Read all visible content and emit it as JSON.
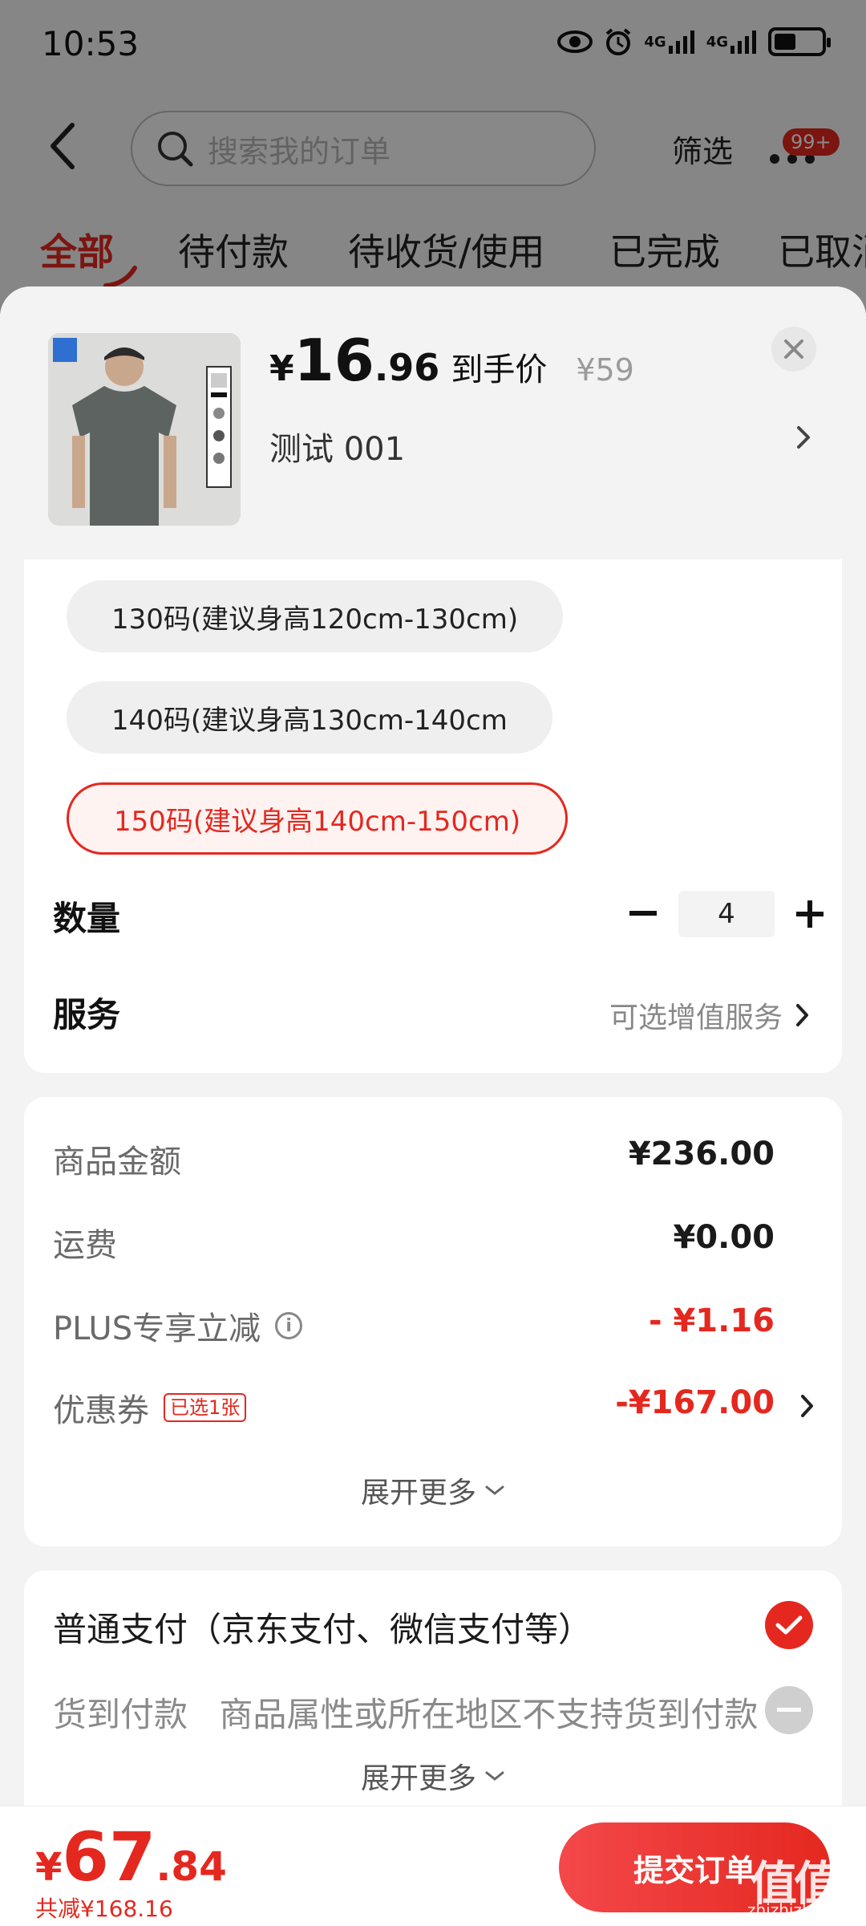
{
  "status_bar": {
    "time": "10:53",
    "signal_1": "4G",
    "signal_2": "4G"
  },
  "top_nav": {
    "search_placeholder": "搜索我的订单",
    "filter_label": "筛选",
    "more_badge": "99+"
  },
  "tabs": [
    {
      "label": "全部",
      "active": true
    },
    {
      "label": "待付款",
      "active": false
    },
    {
      "label": "待收货/使用",
      "active": false
    },
    {
      "label": "已完成",
      "active": false
    },
    {
      "label": "已取消",
      "active": false
    }
  ],
  "product": {
    "price_currency": "¥",
    "price_int": "16",
    "price_dec": ".96",
    "price_tag": "到手价",
    "original_price": "¥59",
    "spec": "测试  001",
    "image_icon": "gray-tshirt-photo"
  },
  "sizes": [
    {
      "label": "130码(建议身高120cm-130cm)",
      "selected": false
    },
    {
      "label": "140码(建议身高130cm-140cm",
      "selected": false
    },
    {
      "label": "150码(建议身高140cm-150cm)",
      "selected": true
    }
  ],
  "quantity": {
    "label": "数量",
    "value": "4"
  },
  "service": {
    "label": "服务",
    "value": "可选增值服务"
  },
  "price_detail": {
    "rows": [
      {
        "label": "商品金额",
        "value": "¥236.00"
      },
      {
        "label": "运费",
        "value": "¥0.00"
      },
      {
        "label": "PLUS专享立减",
        "value": "- ¥1.16"
      },
      {
        "label": "优惠券",
        "tag": "已选1张",
        "value": "-¥167.00"
      }
    ],
    "expand_label": "展开更多"
  },
  "payment": {
    "options": [
      {
        "label": "普通支付（京东支付、微信支付等）",
        "selected": true
      },
      {
        "label": "货到付款",
        "note": "商品属性或所在地区不支持货到付款",
        "selected": false
      }
    ],
    "expand_label": "展开更多"
  },
  "bottom": {
    "total_currency": "¥",
    "total_int": "67",
    "total_dec": ".84",
    "saved": "共减¥168.16",
    "submit_label": "提交订单"
  },
  "watermark": {
    "text": "值值值",
    "sub": "zhizhizhi.com"
  },
  "colors": {
    "accent": "#e4281f",
    "sheet_bg": "#f3f3f3",
    "card_bg": "#ffffff"
  }
}
